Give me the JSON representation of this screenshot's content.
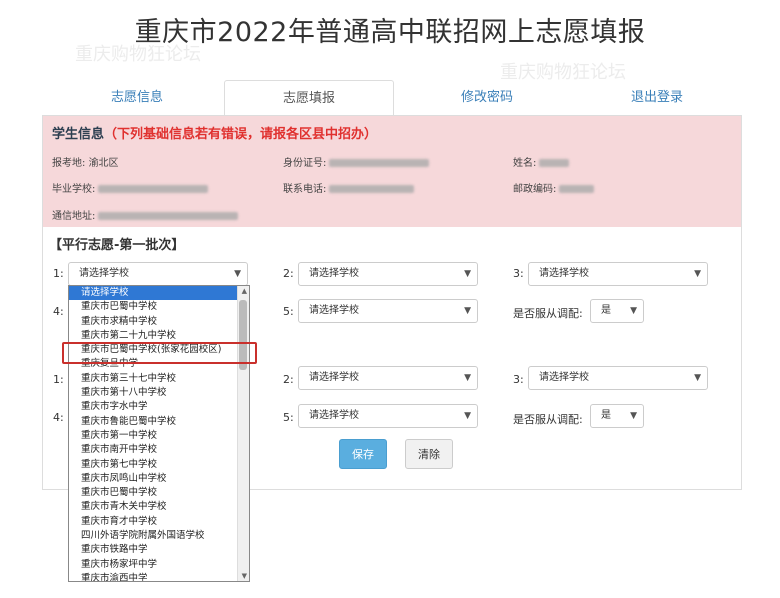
{
  "page": {
    "title": "重庆市2022年普通高中联招网上志愿填报"
  },
  "tabs": [
    {
      "label": "志愿信息"
    },
    {
      "label": "志愿填报"
    },
    {
      "label": "修改密码"
    },
    {
      "label": "退出登录"
    }
  ],
  "student_info": {
    "title": "学生信息",
    "warning": "（下列基础信息若有错误，请报各区县中招办）",
    "exam_area_label": "报考地:",
    "exam_area_value": "渝北区",
    "id_label": "身份证号:",
    "name_label": "姓名:",
    "school_label": "毕业学校:",
    "phone_label": "联系电话:",
    "postcode_label": "邮政编码:",
    "address_label": "通信地址:"
  },
  "section": {
    "title": "【平行志愿-第一批次】"
  },
  "rows": {
    "n1": "1:",
    "n2": "2:",
    "n3": "3:",
    "n4": "4:",
    "n5": "5:",
    "n1b": "1:",
    "n2b": "2:",
    "n3b": "3:",
    "n4b": "4:",
    "n5b": "5:",
    "obey_label": "是否服从调配:",
    "obey_label_b": "是否服从调配:"
  },
  "selects": {
    "placeholder": "请选择学校",
    "obey_value": "是"
  },
  "buttons": {
    "save": "保存",
    "clear": "清除"
  },
  "dropdown": {
    "items": [
      "请选择学校",
      "重庆市巴蜀中学校",
      "重庆市求精中学校",
      "重庆市第二十九中学校",
      "重庆市巴蜀中学校(张家花园校区)",
      "重庆复旦中学",
      "重庆市第三十七中学校",
      "重庆市第十八中学校",
      "重庆市字水中学",
      "重庆市鲁能巴蜀中学校",
      "重庆市第一中学校",
      "重庆市南开中学校",
      "重庆市第七中学校",
      "重庆市凤鸣山中学校",
      "重庆市巴蜀中学校",
      "重庆市青木关中学校",
      "重庆市育才中学校",
      "四川外语学院附属外国语学校",
      "重庆市铁路中学",
      "重庆市杨家坪中学",
      "重庆市渝西中学"
    ]
  },
  "watermark": "重庆购物狂论坛"
}
